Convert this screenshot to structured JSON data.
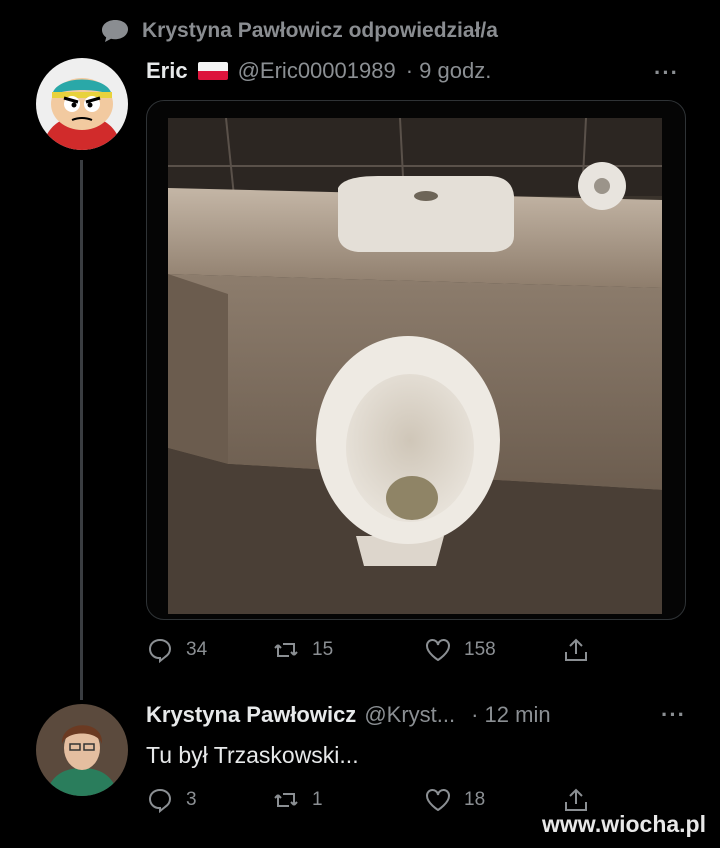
{
  "context": {
    "text": "Krystyna Pawłowicz odpowiedział/a"
  },
  "tweet": {
    "author": "Eric",
    "handle": "@Eric00001989",
    "time": "· 9 godz.",
    "more": "···",
    "replies": "34",
    "retweets": "15",
    "likes": "158"
  },
  "reply": {
    "author": "Krystyna Pawłowicz",
    "handle": "@Kryst...",
    "time": "· 12 min",
    "more": "···",
    "text": "Tu był Trzaskowski...",
    "replies": "3",
    "retweets": "1",
    "likes": "18"
  },
  "watermark": "www.wiocha.pl",
  "colors": {
    "background": "#000000",
    "muted": "#8b8f93",
    "line": "#2f3336",
    "flag_red": "#dc143c"
  },
  "icons": [
    "speech-bubble-icon",
    "flag-poland-icon",
    "reply-icon",
    "retweet-icon",
    "heart-icon",
    "share-icon"
  ]
}
